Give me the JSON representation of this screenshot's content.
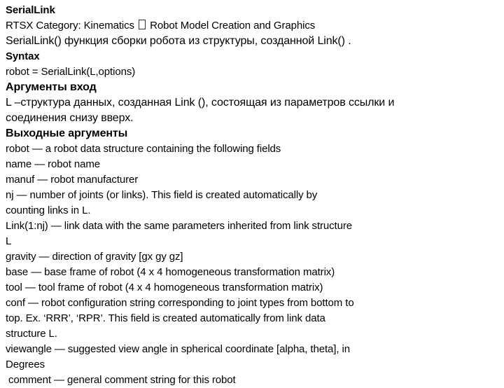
{
  "document": {
    "title": "SerialLink",
    "category_prefix": "RTSX Category: Kinematics",
    "category_suffix": "Robot Model Creation and Graphics",
    "category_separator_icon": "missing-glyph-box",
    "description": "SerialLink() функция сборки робота из структуры, созданной Link() .",
    "syntax_heading": "Syntax",
    "syntax_code": "robot = SerialLink(L,options)",
    "input_args_heading": "Аргументы вход",
    "input_args_text_1": "L –структура данных, созданная Link (), состоящая из параметров ссылки и",
    "input_args_text_2": "соединения снизу вверх.",
    "output_args_heading": "Выходные аргументы",
    "output_lines": [
      "robot — a robot data structure containing the following fields",
      "name — robot name",
      "manuf — robot manufacturer",
      "nj — number of joints (or links). This field is created automatically by",
      "counting links in L.",
      "Link(1:nj) — link data with the same parameters inherited from link structure",
      "L",
      "gravity — direction of gravity [gx gy gz]",
      "base — base frame of robot (4 x 4 homogeneous transformation matrix)",
      "tool — tool frame of robot (4 x 4 homogeneous transformation matrix)",
      "conf — robot configuration string corresponding to joint types from bottom to",
      "top. Ex. ‘RRR’, ‘RPR’. This field is created automatically from link data",
      "structure L.",
      "viewangle — suggested view angle in spherical coordinate [alpha, theta], in",
      "Degrees",
      "comment — general comment string for this robot"
    ]
  }
}
